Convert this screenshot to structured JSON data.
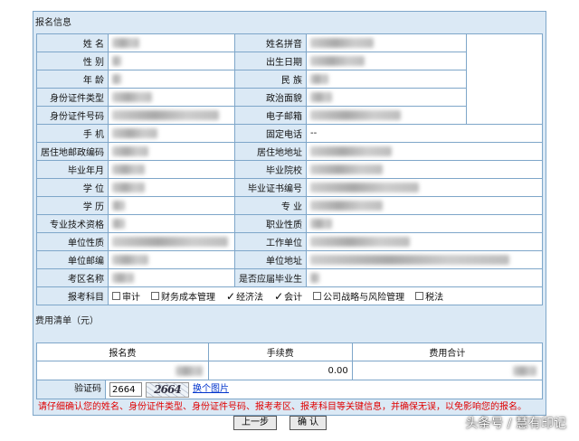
{
  "panel": {
    "title": "报名信息"
  },
  "fields": {
    "name": "姓  名",
    "name_pinyin": "姓名拼音",
    "gender": "性  别",
    "birth_date": "出生日期",
    "age": "年  龄",
    "ethnicity": "民  族",
    "id_type": "身份证件类型",
    "political": "政治面貌",
    "id_number": "身份证件号码",
    "email": "电子邮箱",
    "mobile": "手  机",
    "landline": "固定电话",
    "landline_value": "--",
    "postcode": "居住地邮政编码",
    "address": "居住地地址",
    "grad_date": "毕业年月",
    "school": "毕业院校",
    "degree": "学  位",
    "degree_cert": "毕业证书编号",
    "education": "学  历",
    "major": "专  业",
    "tech_title": "专业技术资格",
    "job_title": "职业性质",
    "unit_type": "单位性质",
    "work_unit": "工作单位",
    "unit_postcode": "单位邮编",
    "unit_address": "单位地址",
    "exam_area": "考区名称",
    "is_graduate": "是否应届毕业生"
  },
  "subjects": {
    "label": "报考科目",
    "items": [
      {
        "name": "审计",
        "checked": false
      },
      {
        "name": "财务成本管理",
        "checked": false
      },
      {
        "name": "经济法",
        "checked": true
      },
      {
        "name": "会计",
        "checked": true
      },
      {
        "name": "公司战略与风险管理",
        "checked": false
      },
      {
        "name": "税法",
        "checked": false
      }
    ]
  },
  "fees": {
    "title": "费用清单（元）",
    "headers": [
      "报名费",
      "手续费",
      "费用合计"
    ],
    "handling_fee": "0.00"
  },
  "captcha": {
    "label": "验证码",
    "value": "2664",
    "image_text": "2664",
    "refresh_label": "换个图片"
  },
  "warning": "请仔细确认您的姓名、身份证件类型、身份证件号码、报考考区、报考科目等关键信息，并确保无误，以免影响您的报名。",
  "buttons": {
    "prev": "上一步",
    "confirm": "确  认"
  },
  "watermark": "头条号 / 慧有印记",
  "colors": {
    "label_bg": "#dbe9f5",
    "border": "#7ea6c9",
    "warning": "#e00000",
    "link": "#0033cc"
  }
}
